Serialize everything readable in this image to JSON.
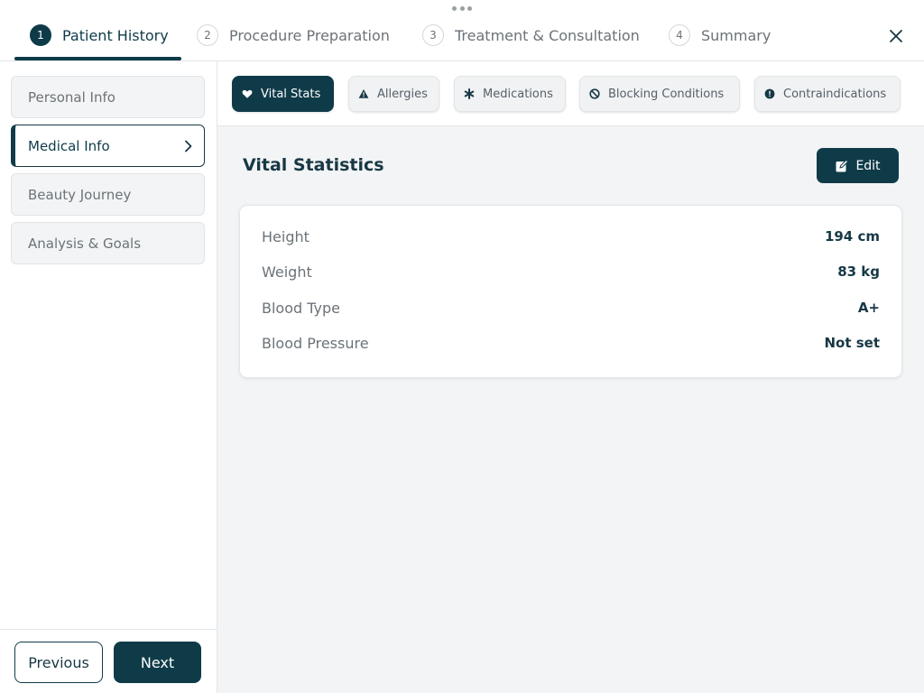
{
  "steps": [
    {
      "num": "1",
      "label": "Patient History"
    },
    {
      "num": "2",
      "label": "Procedure Preparation"
    },
    {
      "num": "3",
      "label": "Treatment & Consultation"
    },
    {
      "num": "4",
      "label": "Summary"
    }
  ],
  "active_step": 0,
  "sidebar": {
    "items": [
      {
        "label": "Personal Info"
      },
      {
        "label": "Medical Info"
      },
      {
        "label": "Beauty Journey"
      },
      {
        "label": "Analysis & Goals"
      }
    ],
    "active_item": 1,
    "previous_label": "Previous",
    "next_label": "Next"
  },
  "tabs": [
    {
      "label": "Vital Stats",
      "icon": "heart-icon"
    },
    {
      "label": "Allergies",
      "icon": "warning-icon"
    },
    {
      "label": "Medications",
      "icon": "asterisk-icon"
    },
    {
      "label": "Blocking Conditions",
      "icon": "ban-icon"
    },
    {
      "label": "Contraindications",
      "icon": "alert-circle-icon"
    }
  ],
  "active_tab": 0,
  "section": {
    "title": "Vital Statistics",
    "edit_label": "Edit"
  },
  "vitals": [
    {
      "label": "Height",
      "value": "194 cm"
    },
    {
      "label": "Weight",
      "value": "83 kg"
    },
    {
      "label": "Blood Type",
      "value": "A+"
    },
    {
      "label": "Blood Pressure",
      "value": "Not set"
    }
  ],
  "colors": {
    "primary": "#0f3b49",
    "muted_text": "#6b7378",
    "background": "#f3f4f5"
  }
}
